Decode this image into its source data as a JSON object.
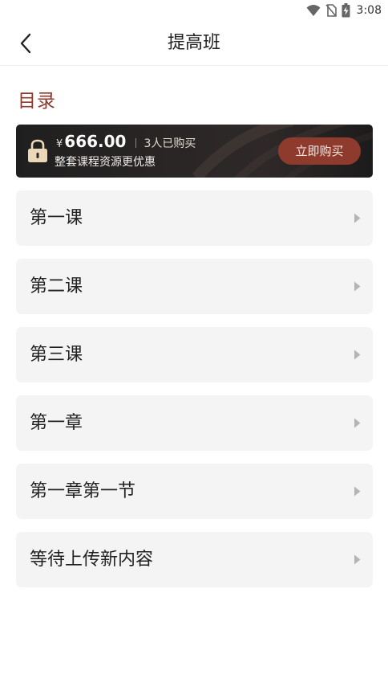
{
  "status_bar": {
    "time": "3:08",
    "icons": [
      "wifi-icon",
      "no-sim-icon",
      "battery-charging-icon"
    ]
  },
  "nav": {
    "title": "提高班",
    "back_icon": "chevron-left-icon"
  },
  "section": {
    "title": "目录"
  },
  "purchase": {
    "currency": "¥",
    "price": "666.00",
    "buyers": "3人已购买",
    "subtitle": "整套课程资源更优惠",
    "button_label": "立即购买",
    "lock_icon": "lock-icon"
  },
  "lessons": [
    {
      "label": "第一课"
    },
    {
      "label": "第二课"
    },
    {
      "label": "第三课"
    },
    {
      "label": "第一章"
    },
    {
      "label": "第一章第一节"
    },
    {
      "label": "等待上传新内容"
    }
  ],
  "colors": {
    "accent": "#8b3a2c",
    "button": "#8e3b2d",
    "banner_bg": "#252221",
    "card_bg": "#f4f4f4"
  }
}
